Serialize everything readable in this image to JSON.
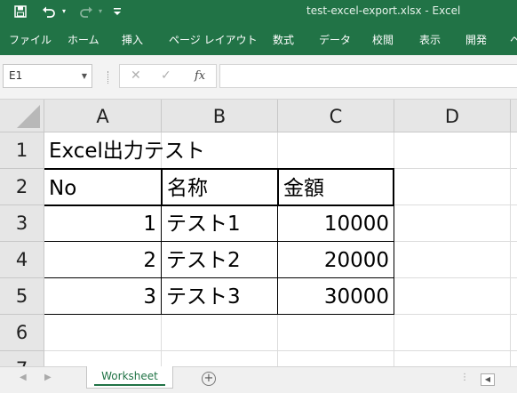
{
  "window": {
    "title": "test-excel-export.xlsx  -  Excel"
  },
  "quick_access": {
    "icons": [
      "save-icon",
      "undo-icon",
      "redo-icon",
      "customize-qat-icon"
    ]
  },
  "ribbon": {
    "tabs": [
      {
        "label": "ファイル"
      },
      {
        "label": "ホーム"
      },
      {
        "label": "挿入"
      },
      {
        "label": "ページ レイアウト"
      },
      {
        "label": "数式"
      },
      {
        "label": "データ"
      },
      {
        "label": "校閲"
      },
      {
        "label": "表示"
      },
      {
        "label": "開発"
      },
      {
        "label": "ヘ"
      }
    ]
  },
  "formula_bar": {
    "name_box": "E1",
    "cancel_glyph": "✕",
    "enter_glyph": "✓",
    "fx_label": "fx",
    "formula_value": ""
  },
  "grid": {
    "columns": [
      "A",
      "B",
      "C",
      "D"
    ],
    "rows": [
      "1",
      "2",
      "3",
      "4",
      "5",
      "6",
      "7"
    ],
    "cells": {
      "A1": "Excel出力テスト",
      "A2": "No",
      "B2": "名称",
      "C2": "金額",
      "A3": "1",
      "B3": "テスト1",
      "C3": "10000",
      "A4": "2",
      "B4": "テスト2",
      "C4": "20000",
      "A5": "3",
      "B5": "テスト3",
      "C5": "30000"
    }
  },
  "sheets": {
    "tabs": [
      {
        "label": "Worksheet",
        "active": true
      }
    ],
    "add_label": "+",
    "prev_glyph": "◀",
    "next_glyph": "▶",
    "scroll_left_glyph": "◀",
    "dots": "⋮"
  },
  "colors": {
    "brand": "#217346",
    "header_bg": "#e6e6e6",
    "gridline": "#dcdcdc"
  }
}
